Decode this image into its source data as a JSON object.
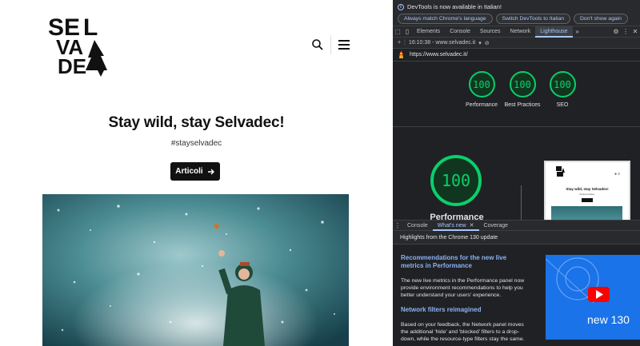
{
  "website": {
    "logo_text": "SELVADEC",
    "hero": {
      "title": "Stay wild, stay Selvadec!",
      "subtitle": "#stayselvadec",
      "cta_label": "Articoli",
      "cta_icon": "arrow-right-icon"
    },
    "header_icons": [
      "search-icon",
      "hamburger-menu-icon"
    ]
  },
  "devtools": {
    "infobar": {
      "message": "DevTools is now available in Italian!",
      "buttons": [
        "Always match Chrome's language",
        "Switch DevTools to Italian",
        "Don't show again"
      ]
    },
    "tabs": [
      {
        "label": "Elements"
      },
      {
        "label": "Console"
      },
      {
        "label": "Sources"
      },
      {
        "label": "Network"
      },
      {
        "label": "Lighthouse"
      }
    ],
    "active_tab": "Lighthouse",
    "toolbar": {
      "report_label": "16:10:38 - www.selvadec.it"
    },
    "url": "https://www.selvadec.it/",
    "scores": [
      {
        "label": "Performance",
        "value": "100"
      },
      {
        "label": "Best Practices",
        "value": "100"
      },
      {
        "label": "SEO",
        "value": "100"
      }
    ],
    "main_score": {
      "label": "Performance",
      "value": "100"
    },
    "drawer": {
      "tabs": [
        {
          "label": "Console"
        },
        {
          "label": "What's new"
        },
        {
          "label": "Coverage"
        }
      ],
      "header": "Highlights from the Chrome 130 update",
      "items": [
        {
          "heading": "Recommendations for the new live metrics in Performance",
          "body": "The new live metrics in the Performance panel now provide environment recommendations to help you better understand your users' experience."
        },
        {
          "heading": "Network filters reimagined",
          "body": "Based on your feedback, the Network panel moves the additional 'hide' and 'blocked' filters to a drop-down, while the resource-type filters stay the same."
        }
      ],
      "promo_text": "new 130"
    },
    "colors": {
      "score_green": "#0cce6b",
      "accent_blue": "#a8c7fa",
      "background": "#202124"
    }
  }
}
